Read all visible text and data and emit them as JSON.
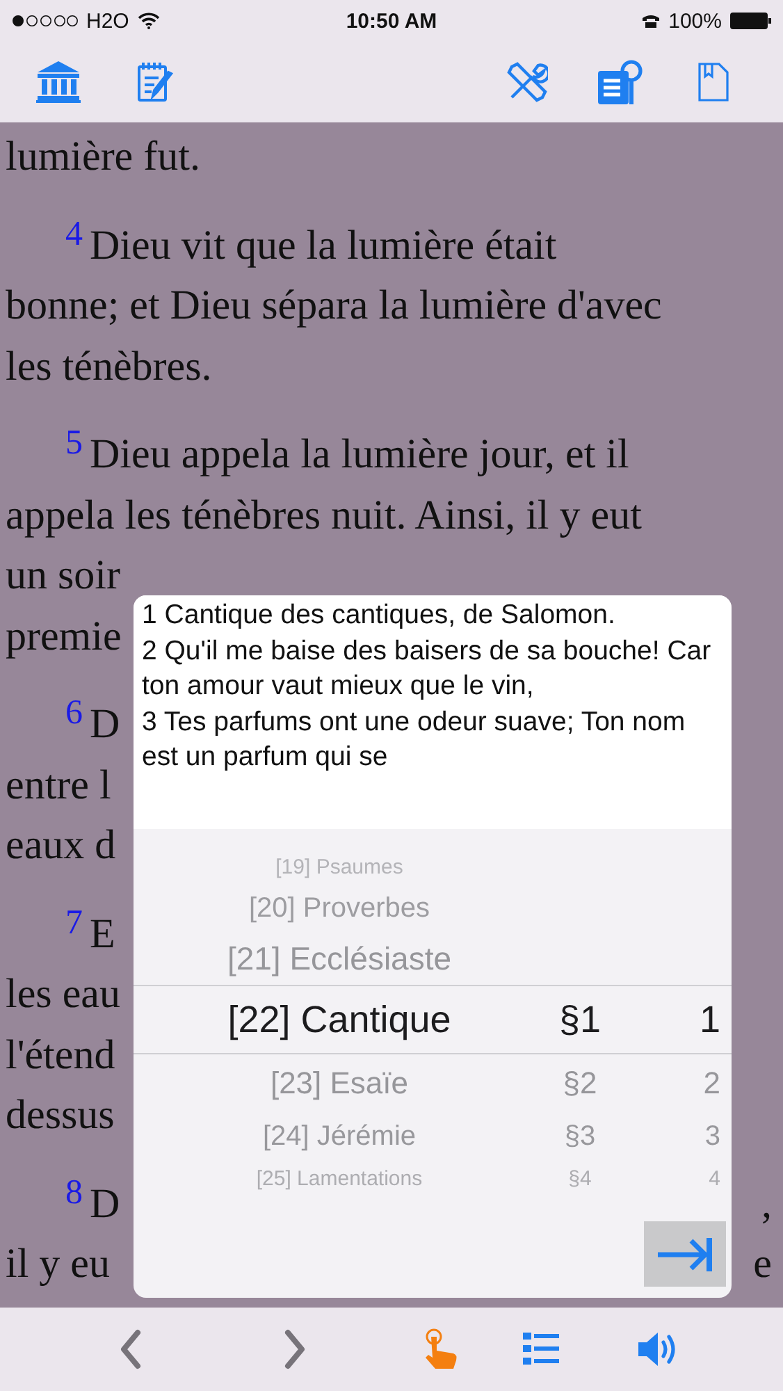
{
  "status_bar": {
    "carrier": "H2O",
    "time": "10:50 AM",
    "battery": "100%"
  },
  "reading": {
    "lines": [
      {
        "text": "lumière fut."
      },
      {
        "number": "4",
        "text": "Dieu vit que la lumière était"
      },
      {
        "text": "bonne; et Dieu sépara la lumière d'avec"
      },
      {
        "text": "les ténèbres."
      },
      {
        "number": "5",
        "text": "Dieu appela la lumière jour, et il"
      },
      {
        "text": "appela les ténèbres nuit. Ainsi, il y eut"
      },
      {
        "text": "un soir"
      },
      {
        "text": "premie"
      },
      {
        "number": "6",
        "text": "D"
      },
      {
        "text": "entre l"
      },
      {
        "text": "eaux d"
      },
      {
        "number": "7",
        "text": "E"
      },
      {
        "text": "les eau"
      },
      {
        "text": "l'étend"
      },
      {
        "text": "dessus"
      },
      {
        "number": "8",
        "text": "D",
        "tail": ","
      },
      {
        "text": "il y eu",
        "tail": "e"
      }
    ]
  },
  "popup": {
    "preview": [
      "1 Cantique des cantiques, de Salomon.",
      "2 Qu'il me baise des baisers de sa bouche! Car ton amour vaut mieux que le vin,",
      "3 Tes parfums ont une odeur suave; Ton nom est un parfum qui se"
    ],
    "picker": {
      "rows": [
        {
          "book": "[19] Psaumes",
          "selected": false
        },
        {
          "book": "[20] Proverbes",
          "selected": false
        },
        {
          "book": "[21] Ecclésiaste",
          "selected": false
        },
        {
          "book": "[22] Cantique",
          "chapter": "§1",
          "verse": "1",
          "selected": true
        },
        {
          "book": "[23] Esaïe",
          "chapter": "§2",
          "verse": "2",
          "selected": false
        },
        {
          "book": "[24] Jérémie",
          "chapter": "§3",
          "verse": "3",
          "selected": false
        },
        {
          "book": "[25] Lamentations",
          "chapter": "§4",
          "verse": "4",
          "selected": false
        }
      ]
    }
  }
}
